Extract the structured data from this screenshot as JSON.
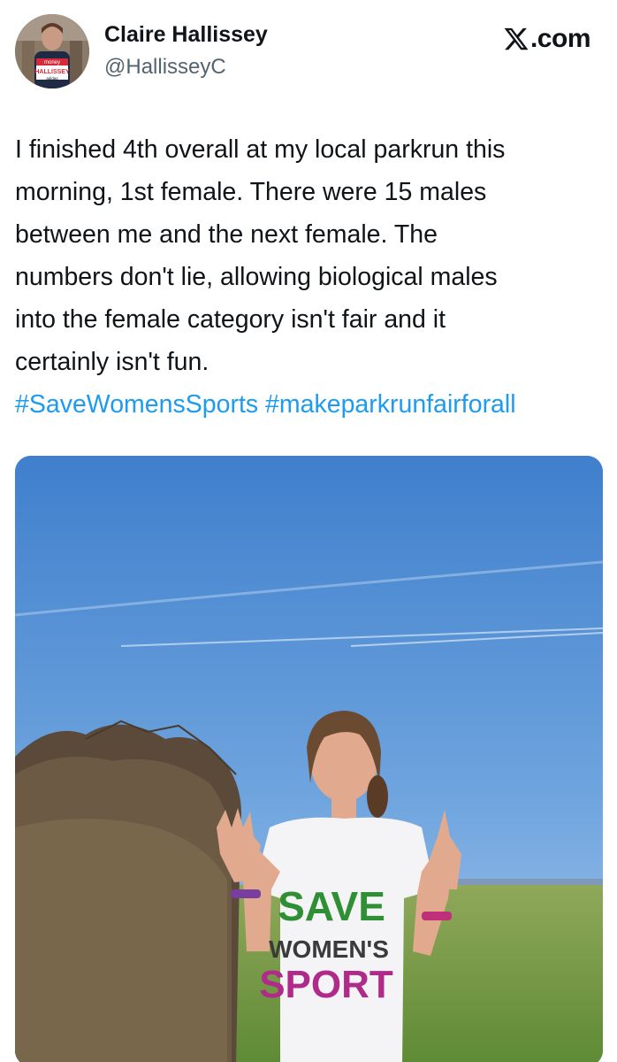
{
  "author": {
    "name": "Claire Hallissey",
    "handle": "@HallisseyC",
    "avatar_bib_text": "HALLISSEY",
    "avatar_sponsor_text": "adidas",
    "avatar_brand_text": "money"
  },
  "source": {
    "logo_icon": "x-logo-icon",
    "label": ".com"
  },
  "tweet": {
    "lines": [
      "I finished 4th overall at my local parkrun this",
      "morning, 1st female. There were 15 males",
      "between me and the next female. The",
      "numbers don't lie, allowing biological males",
      "into the female category isn't fair and it",
      "certainly isn't fun."
    ],
    "hashtags": [
      "#SaveWomensSports",
      "#makeparkrunfairforall"
    ]
  },
  "media": {
    "shirt_text_line1": "SAVE",
    "shirt_text_line2": "WOMEN'S",
    "shirt_text_line3": "SPORT"
  },
  "colors": {
    "hashtag": "#1d9bf0",
    "handle": "#536471",
    "text": "#0f1419"
  }
}
